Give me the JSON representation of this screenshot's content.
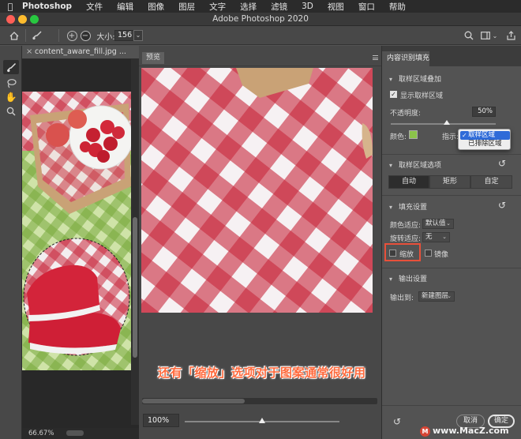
{
  "menubar": {
    "app_name": "Photoshop",
    "items": [
      "文件",
      "编辑",
      "图像",
      "图层",
      "文字",
      "选择",
      "滤镜",
      "3D",
      "视图",
      "窗口",
      "帮助"
    ]
  },
  "window": {
    "title": "Adobe Photoshop 2020"
  },
  "options_bar": {
    "size_label": "大小:",
    "size_value": "156"
  },
  "document": {
    "tab_name": "content_aware_fill.jpg ...",
    "zoom": "66.67%"
  },
  "preview": {
    "tab_label": "预览",
    "zoom": "100%",
    "zoom_slider_fraction": 0.5
  },
  "panel": {
    "tab_label": "内容识别填充",
    "sampling_overlay": {
      "title": "取样区域叠加",
      "show_sampling_label": "显示取样区域",
      "show_sampling_checked": true,
      "opacity_label": "不透明度:",
      "opacity_value": "50%",
      "color_label": "颜色:",
      "color_value": "#8bc34a",
      "indicate_label": "指示:",
      "indicate_options": [
        "取样区域",
        "已排除区域"
      ],
      "indicate_selected": "取样区域"
    },
    "sampling_options": {
      "title": "取样区域选项",
      "buttons": [
        "自动",
        "矩形",
        "自定"
      ],
      "selected": "自动"
    },
    "fill_settings": {
      "title": "填充设置",
      "color_adapt_label": "颜色适应:",
      "color_adapt_value": "默认值",
      "rotation_adapt_label": "旋转适应:",
      "rotation_adapt_value": "无",
      "scale_label": "缩放",
      "scale_checked": false,
      "mirror_label": "镜像",
      "mirror_checked": false
    },
    "output_settings": {
      "title": "输出设置",
      "output_to_label": "输出到:",
      "output_to_value": "新建图层"
    },
    "cancel_label": "取消",
    "ok_label": "确定"
  },
  "caption": "还有「缩放」选项对于图案通常很好用",
  "watermark": "www.MacZ.com",
  "colors": {
    "checker_red": "#c8283c",
    "sample_green": "#8bc34a",
    "highlight_red": "#e8503a",
    "caption_orange": "#ff6a3d"
  }
}
